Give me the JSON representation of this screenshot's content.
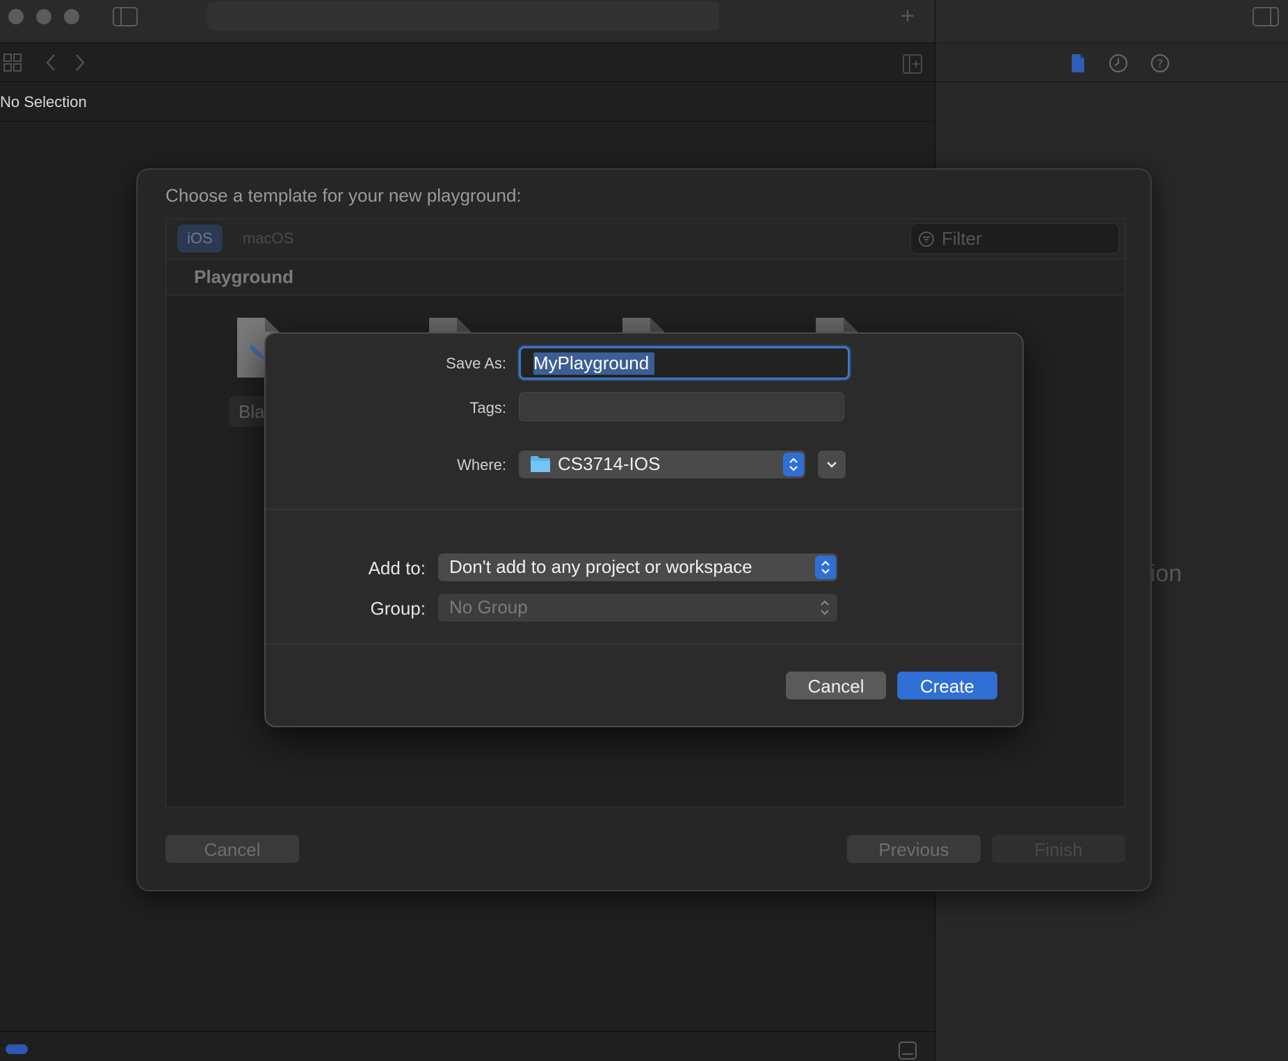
{
  "window": {
    "traffic_lights": [
      "close",
      "minimize",
      "zoom"
    ],
    "plus_symbol": "+"
  },
  "editor": {
    "no_selection_label": "No Selection"
  },
  "inspector": {
    "partial_text": "ion",
    "tabs": [
      "file-inspector-icon",
      "history-icon",
      "help-icon"
    ]
  },
  "template_sheet": {
    "heading": "Choose a template for your new playground:",
    "platform_tabs": [
      {
        "label": "iOS",
        "active": true
      },
      {
        "label": "macOS",
        "active": false
      }
    ],
    "filter_placeholder": "Filter",
    "section_title": "Playground",
    "selected_template_partial_label": "Blar",
    "buttons": {
      "cancel": "Cancel",
      "previous": "Previous",
      "finish": "Finish"
    }
  },
  "save_dialog": {
    "save_as_label": "Save As:",
    "save_as_value": "MyPlayground",
    "tags_label": "Tags:",
    "tags_value": "",
    "where_label": "Where:",
    "where_value": "CS3714-IOS",
    "add_to_label": "Add to:",
    "add_to_value": "Don't add to any project or workspace",
    "group_label": "Group:",
    "group_value": "No Group",
    "cancel_label": "Cancel",
    "create_label": "Create"
  },
  "colors": {
    "accent_blue": "#2f6fd6",
    "focus_ring": "#3b79c5",
    "dialog_bg": "#2b2b2b",
    "window_bg": "#1e1e1e"
  }
}
